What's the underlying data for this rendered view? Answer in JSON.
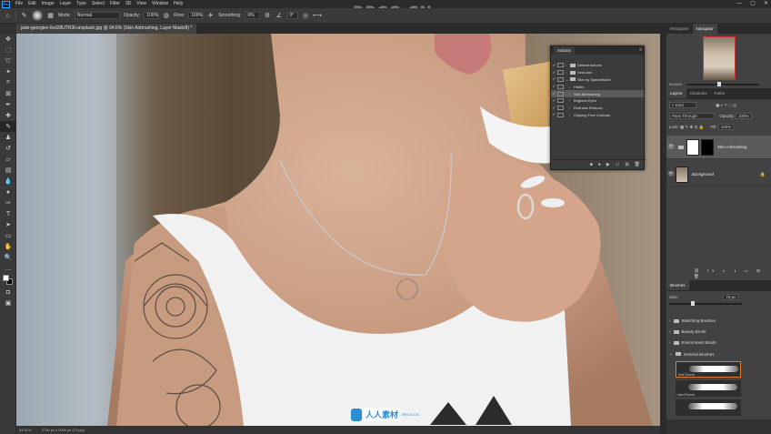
{
  "menubar": {
    "items": [
      "File",
      "Edit",
      "Image",
      "Layer",
      "Type",
      "Select",
      "Filter",
      "3D",
      "View",
      "Window",
      "Help"
    ],
    "watermark": "RRCG.CN"
  },
  "options": {
    "mode_label": "Mode:",
    "mode_value": "Normal",
    "opacity_label": "Opacity:",
    "opacity_value": "100%",
    "flow_label": "Flow:",
    "flow_value": "100%",
    "smoothing_label": "Smoothing:",
    "smoothing_value": "0%",
    "angle_value": "0°"
  },
  "document": {
    "tab_title": "jade-georgiev-Ikol28UTR3l-unsplash.jpg @ 94.6% (Skin Airbrushing, Layer Mask/8) *",
    "zoom": "94.61%",
    "dimensions": "2736 px x 2000 px (72 ppi)"
  },
  "navigator": {
    "tabs": [
      "Histogram",
      "Navigator"
    ],
    "zoom": "94.61%"
  },
  "layers": {
    "tabs": [
      "Layers",
      "Channels",
      "Paths"
    ],
    "kind_label": "Kind",
    "blend_mode": "Pass Through",
    "opacity_label": "Opacity:",
    "opacity_value": "100%",
    "lock_label": "Lock:",
    "fill_label": "Fill:",
    "fill_value": "100%",
    "items": [
      {
        "name": "Skin Airbrushing"
      },
      {
        "name": "Background"
      }
    ]
  },
  "brushes": {
    "title": "Brushes",
    "size_label": "Size:",
    "size_value": "75 px",
    "folders": [
      "Sketching Brushes",
      "Beauty Brush",
      "Environment Brush",
      "General Brushes"
    ],
    "tiles": [
      "Soft Round",
      "Hard Round"
    ]
  },
  "actions": {
    "title": "Actions",
    "rows": [
      {
        "label": "Default Actions",
        "type": "folder"
      },
      {
        "label": "OneLove",
        "type": "folder"
      },
      {
        "label": "Skin by SparkleMark",
        "type": "folder-open"
      },
      {
        "label": "Hiddin",
        "type": "action"
      },
      {
        "label": "Skin Airbrushing",
        "type": "action"
      },
      {
        "label": "Brighten Eyes",
        "type": "action"
      },
      {
        "label": "Redness Reducer",
        "type": "action"
      },
      {
        "label": "Clipping Free Contrast",
        "type": "action"
      }
    ]
  },
  "watermark_bottom": {
    "main": "人人素材",
    "sub": "RRCG.CN"
  }
}
